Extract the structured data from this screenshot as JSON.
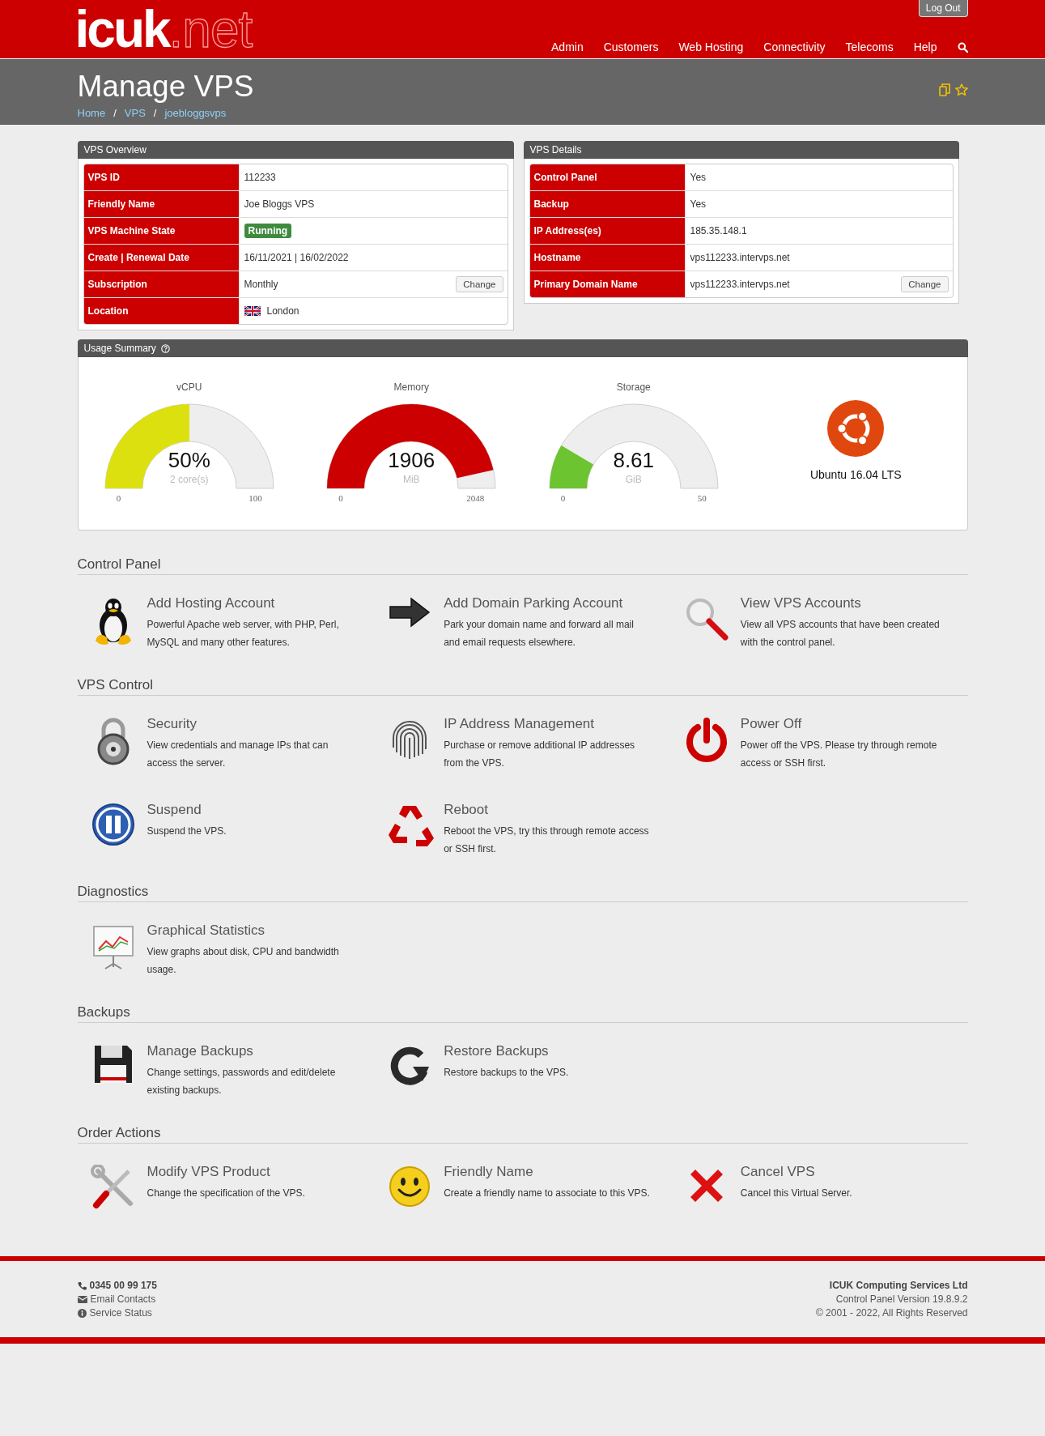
{
  "header": {
    "logo_main": "icuk",
    "logo_suffix": ".net",
    "logout_button": "Log Out",
    "nav": [
      "Admin",
      "Customers",
      "Web Hosting",
      "Connectivity",
      "Telecoms",
      "Help"
    ]
  },
  "page": {
    "title": "Manage VPS",
    "breadcrumb": [
      {
        "kind": "link",
        "text": "Home"
      },
      {
        "kind": "separator",
        "text": "/"
      },
      {
        "kind": "link",
        "text": "VPS"
      },
      {
        "kind": "separator",
        "text": "/"
      },
      {
        "kind": "link",
        "text": "joebloggsvps"
      }
    ]
  },
  "overview": {
    "title": "VPS Overview",
    "rows": [
      {
        "label": "VPS ID",
        "kind": "text",
        "value": "112233"
      },
      {
        "label": "Friendly Name",
        "kind": "text",
        "value": "Joe Bloggs VPS"
      },
      {
        "label": "VPS Machine State",
        "kind": "badge",
        "value": "Running"
      },
      {
        "label": "Create | Renewal Date",
        "kind": "text",
        "value": "16/11/2021 | 16/02/2022"
      },
      {
        "label": "Subscription",
        "kind": "text",
        "value": "Monthly",
        "button": "Change"
      },
      {
        "label": "Location",
        "kind": "flag",
        "value": "London"
      }
    ]
  },
  "details": {
    "title": "VPS Details",
    "rows": [
      {
        "label": "Control Panel",
        "kind": "text",
        "value": "Yes"
      },
      {
        "label": "Backup",
        "kind": "text",
        "value": "Yes"
      },
      {
        "label": "IP Address(es)",
        "kind": "text",
        "value": "185.35.148.1"
      },
      {
        "label": "Hostname",
        "kind": "text",
        "value": "vps112233.intervps.net"
      },
      {
        "label": "Primary Domain Name",
        "kind": "text",
        "value": "vps112233.intervps.net",
        "button": "Change"
      }
    ]
  },
  "usage": {
    "title": "Usage Summary",
    "gauges": [
      {
        "label": "vCPU",
        "value": "50%",
        "unit": "2 core(s)",
        "min": "0",
        "max": "100",
        "level": 0.5,
        "color": "#dde00f"
      },
      {
        "label": "Memory",
        "value": "1906",
        "unit": "MiB",
        "min": "0",
        "max": "2048",
        "level": 0.93,
        "color": "#cc0000"
      },
      {
        "label": "Storage",
        "value": "8.61",
        "unit": "GiB",
        "min": "0",
        "max": "50",
        "level": 0.17,
        "color": "#6cc431"
      }
    ],
    "os": "Ubuntu 16.04 LTS"
  },
  "sections": [
    {
      "title": "Control Panel",
      "items": [
        {
          "kind": "penguin",
          "title": "Add Hosting Account",
          "description": "Powerful Apache web server, with PHP, Perl, MySQL and many other features."
        },
        {
          "kind": "arrow",
          "title": "Add Domain Parking Account",
          "description": "Park your domain name and forward all mail and email requests elsewhere."
        },
        {
          "kind": "magnifier",
          "title": "View VPS Accounts",
          "description": "View all VPS accounts that have been created with the control panel."
        }
      ]
    },
    {
      "title": "VPS Control",
      "items": [
        {
          "kind": "padlock",
          "title": "Security",
          "description": "View credentials and manage IPs that can access the server."
        },
        {
          "kind": "fingerprint",
          "title": "IP Address Management",
          "description": "Purchase or remove additional IP addresses from the VPS."
        },
        {
          "kind": "power",
          "title": "Power Off",
          "description": "Power off the VPS. Please try through remote access or SSH first."
        },
        {
          "kind": "pause",
          "title": "Suspend",
          "description": "Suspend the VPS."
        },
        {
          "kind": "recycle",
          "title": "Reboot",
          "description": "Reboot the VPS, try this through remote access or SSH first."
        }
      ]
    },
    {
      "title": "Diagnostics",
      "items": [
        {
          "kind": "chart",
          "title": "Graphical Statistics",
          "description": "View graphs about disk, CPU and bandwidth usage."
        }
      ]
    },
    {
      "title": "Backups",
      "items": [
        {
          "kind": "floppy",
          "title": "Manage Backups",
          "description": "Change settings, passwords and edit/delete existing backups."
        },
        {
          "kind": "restore",
          "title": "Restore Backups",
          "description": "Restore backups to the VPS."
        }
      ]
    },
    {
      "title": "Order Actions",
      "items": [
        {
          "kind": "tools",
          "title": "Modify VPS Product",
          "description": "Change the specification of the VPS."
        },
        {
          "kind": "smiley",
          "title": "Friendly Name",
          "description": "Create a friendly name to associate to this VPS."
        },
        {
          "kind": "cross",
          "title": "Cancel VPS",
          "description": "Cancel this Virtual Server."
        }
      ]
    }
  ],
  "footer": {
    "contacts": [
      {
        "kind": "phone",
        "text": "0345 00 99 175"
      },
      {
        "kind": "email",
        "text": "Email Contacts"
      },
      {
        "kind": "info",
        "text": "Service Status"
      }
    ],
    "company": "ICUK Computing Services Ltd",
    "version": "Control Panel Version 19.8.9.2",
    "copyright": "© 2001 - 2022, All Rights Reserved"
  }
}
